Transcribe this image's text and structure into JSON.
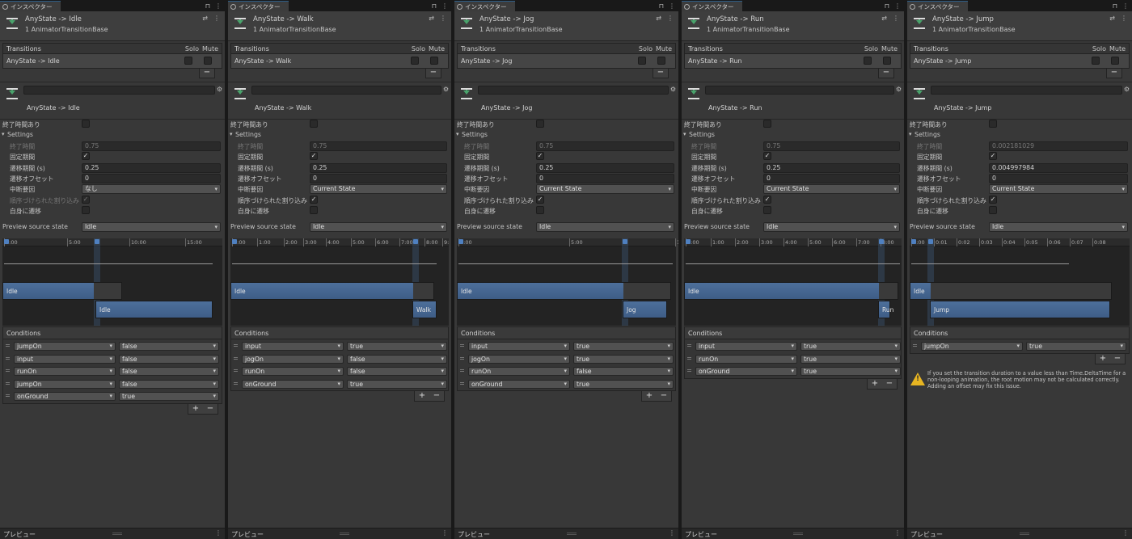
{
  "tab_label": "インスペクター",
  "footer_label": "プレビュー",
  "transitions_label": "Transitions",
  "solo_label": "Solo",
  "mute_label": "Mute",
  "component_label": "1 AnimatorTransitionBase",
  "conditions_label": "Conditions",
  "has_exit_label": "終了時間あり",
  "settings_label": "Settings",
  "exit_time_label": "終了時間",
  "fixed_duration_label": "固定期間",
  "duration_label": "遷移期間 (s)",
  "offset_label": "遷移オフセット",
  "interrupt_label": "中断要因",
  "ordered_label": "順序づけられた割り込み",
  "self_label": "自身に遷移",
  "preview_label": "Preview source state",
  "panels": [
    {
      "title": "AnyState -> Idle",
      "exit_time": "0.75",
      "duration": "0.25",
      "offset": "0",
      "interrupt": "なし",
      "preview": "Idle",
      "from": "Idle",
      "to": "Idle",
      "ticks": [
        "0:00",
        "5:00",
        "10:00",
        "15:00"
      ],
      "conditions": [
        {
          "param": "jumpOn",
          "value": "false"
        },
        {
          "param": "input",
          "value": "false"
        },
        {
          "param": "runOn",
          "value": "false"
        },
        {
          "param": "jumpOn",
          "value": "false"
        },
        {
          "param": "onGround",
          "value": "true"
        }
      ]
    },
    {
      "title": "AnyState -> Walk",
      "exit_time": "0.75",
      "duration": "0.25",
      "offset": "0",
      "interrupt": "Current State",
      "preview": "Idle",
      "from": "Idle",
      "to": "Walk",
      "ticks": [
        "0:00",
        "1:00",
        "2:00",
        "3:00",
        "4:00",
        "5:00",
        "6:00",
        "7:00",
        "8:00",
        "9:"
      ],
      "conditions": [
        {
          "param": "input",
          "value": "true"
        },
        {
          "param": "jogOn",
          "value": "false"
        },
        {
          "param": "runOn",
          "value": "false"
        },
        {
          "param": "onGround",
          "value": "true"
        }
      ]
    },
    {
      "title": "AnyState -> Jog",
      "exit_time": "0.75",
      "duration": "0.25",
      "offset": "0",
      "interrupt": "Current State",
      "preview": "Idle",
      "from": "Idle",
      "to": "Jog",
      "ticks": [
        "0:00",
        "5:00",
        "10"
      ],
      "conditions": [
        {
          "param": "input",
          "value": "true"
        },
        {
          "param": "jogOn",
          "value": "true"
        },
        {
          "param": "runOn",
          "value": "false"
        },
        {
          "param": "onGround",
          "value": "true"
        }
      ]
    },
    {
      "title": "AnyState -> Run",
      "exit_time": "0.75",
      "duration": "0.25",
      "offset": "0",
      "interrupt": "Current State",
      "preview": "Idle",
      "from": "Idle",
      "to": "Run",
      "ticks": [
        "0:00",
        "1:00",
        "2:00",
        "3:00",
        "4:00",
        "5:00",
        "6:00",
        "7:00",
        "8:00"
      ],
      "conditions": [
        {
          "param": "input",
          "value": "true"
        },
        {
          "param": "runOn",
          "value": "true"
        },
        {
          "param": "onGround",
          "value": "true"
        }
      ]
    },
    {
      "title": "AnyState -> Jump",
      "exit_time": "0.002181029",
      "duration": "0.004997984",
      "offset": "0",
      "interrupt": "Current State",
      "preview": "Idle",
      "from": "Idle",
      "to": "Jump",
      "ticks": [
        "0:00",
        "0:01",
        "0:02",
        "0:03",
        "0:04",
        "0:05",
        "0:06",
        "0:07",
        "0:08"
      ],
      "conditions": [
        {
          "param": "jumpOn",
          "value": "true"
        }
      ],
      "warning": "If you set the transition duration to a value less than Time.DeltaTime for a non-looping animation, the root motion may not be calculated correctly. Adding an offset may fix this issue."
    }
  ]
}
